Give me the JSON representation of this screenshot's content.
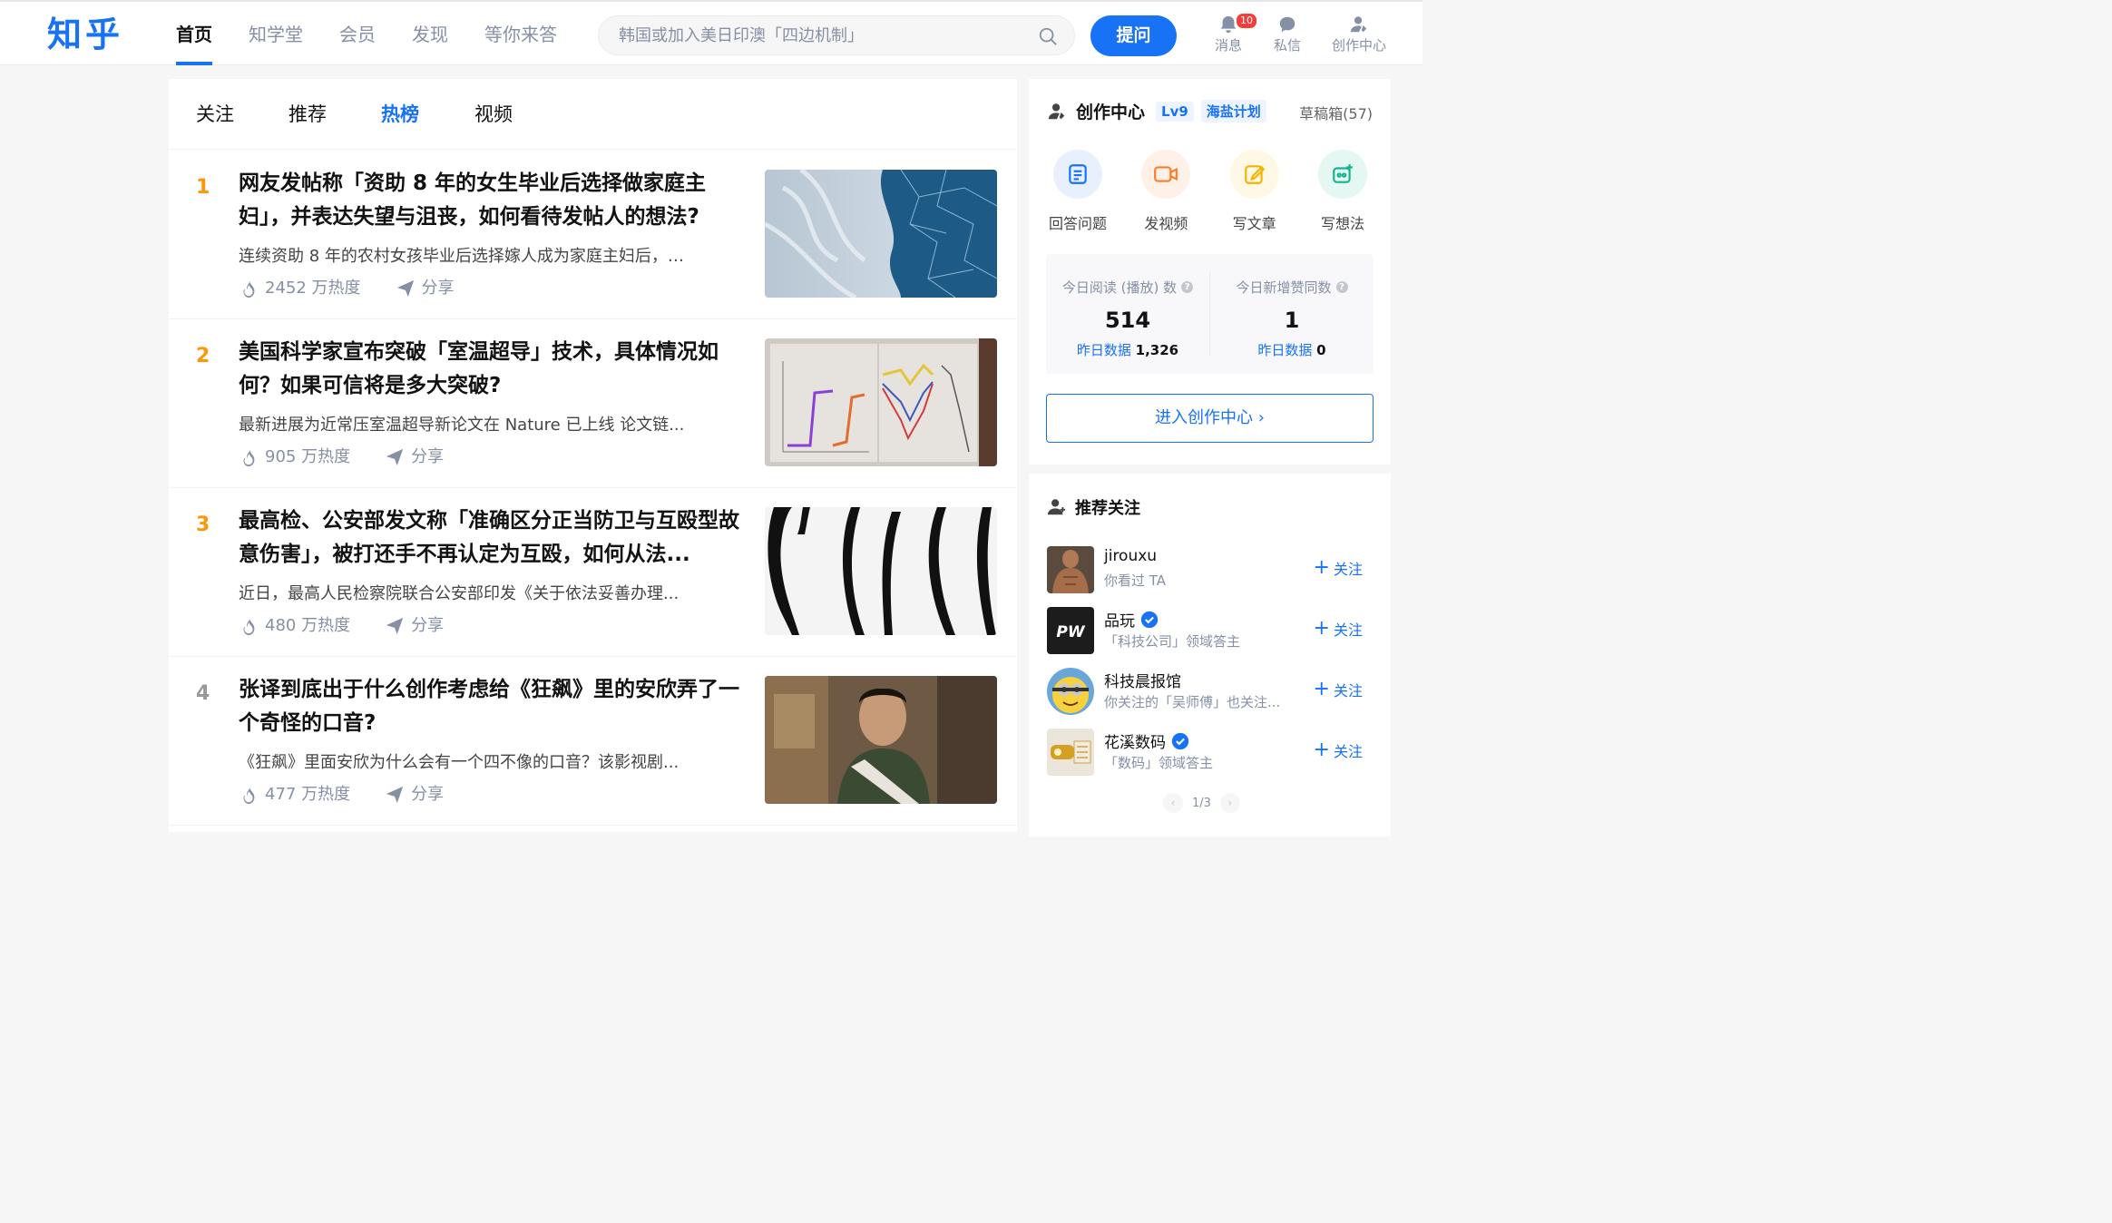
{
  "header": {
    "logo": "知乎",
    "nav": [
      "首页",
      "知学堂",
      "会员",
      "发现",
      "等你来答"
    ],
    "search_placeholder": "韩国或加入美日印澳「四边机制」",
    "ask_label": "提问",
    "icons": [
      {
        "label": "消息",
        "badge": "10",
        "icon": "bell-icon"
      },
      {
        "label": "私信",
        "icon": "chat-icon"
      },
      {
        "label": "创作中心",
        "icon": "creator-icon"
      }
    ],
    "accent": "#1772f6"
  },
  "tabs": [
    "关注",
    "推荐",
    "热榜",
    "视频"
  ],
  "active_tab": "热榜",
  "hot_list": [
    {
      "rank": "1",
      "title": "网友发帖称「资助 8 年的女生毕业后选择做家庭主妇」，并表达失望与沮丧，如何看待发帖人的想法?",
      "excerpt": "连续资助 8 年的农村女孩毕业后选择嫁人成为家庭主妇后，…",
      "heat": "2452 万热度",
      "share": "分享"
    },
    {
      "rank": "2",
      "title": "美国科学家宣布突破「室温超导」技术，具体情况如何？如果可信将是多大突破?",
      "excerpt": "最新进展为近常压室温超导新论文在 Nature 已上线 论文链...",
      "heat": "905 万热度",
      "share": "分享"
    },
    {
      "rank": "3",
      "title": "最高检、公安部发文称「准确区分正当防卫与互殴型故意伤害」，被打还手不再认定为互殴，如何从法...",
      "excerpt": "近日，最高人民检察院联合公安部印发《关于依法妥善办理...",
      "heat": "480 万热度",
      "share": "分享"
    },
    {
      "rank": "4",
      "title": "张译到底出于什么创作考虑给《狂飙》里的安欣弄了一个奇怪的口音?",
      "excerpt": "《狂飙》里面安欣为什么会有一个四不像的口音？该影视剧...",
      "heat": "477 万热度",
      "share": "分享"
    }
  ],
  "creator": {
    "title": "创作中心",
    "level": "Lv9",
    "plan": "海盐计划",
    "drafts": "草稿箱(57)",
    "actions": [
      "回答问题",
      "发视频",
      "写文章",
      "写想法"
    ],
    "stats": [
      {
        "label": "今日阅读 (播放) 数",
        "value": "514",
        "yesterday_label": "昨日数据",
        "yesterday_value": "1,326"
      },
      {
        "label": "今日新增赞同数",
        "value": "1",
        "yesterday_label": "昨日数据",
        "yesterday_value": "0"
      }
    ],
    "enter_label": "进入创作中心 ›"
  },
  "recommend": {
    "title": "推荐关注",
    "users": [
      {
        "name": "jirouxu",
        "sub": "你看过 TA",
        "verified": false,
        "follow": "关注"
      },
      {
        "name": "品玩",
        "sub": "「科技公司」领域答主",
        "verified": true,
        "follow": "关注"
      },
      {
        "name": "科技晨报馆",
        "sub": "你关注的「吴师傅」也关注...",
        "verified": false,
        "follow": "关注"
      },
      {
        "name": "花溪数码",
        "sub": "「数码」领域答主",
        "verified": true,
        "follow": "关注"
      }
    ],
    "pager": "1/3"
  }
}
